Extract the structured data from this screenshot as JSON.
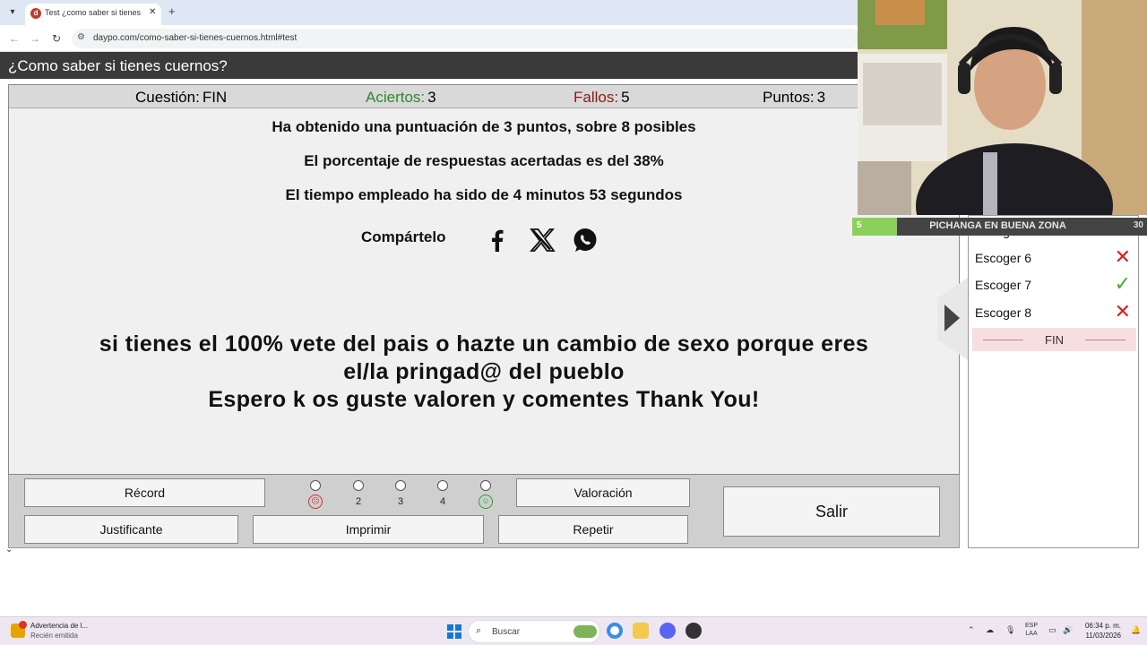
{
  "browser": {
    "tab_title": "Test ¿como saber si tienes cuernos?",
    "favicon_letter": "d",
    "url": "daypo.com/como-saber-si-tienes-cuernos.html#test"
  },
  "page": {
    "title": "¿Como saber si tienes cuernos?"
  },
  "stats": {
    "question_label": "Cuestión:",
    "question_value": "FIN",
    "correct_label": "Aciertos:",
    "correct_value": "3",
    "wrong_label": "Fallos:",
    "wrong_value": "5",
    "points_label": "Puntos:",
    "points_value": "3"
  },
  "results": {
    "line1": "Ha obtenido una puntuación de 3 puntos, sobre 8 posibles",
    "line2": "El porcentaje de respuestas acertadas es del 38%",
    "line3": "El tiempo empleado ha sido de 4 minutos 53 segundos",
    "share_label": "Compártelo",
    "share_icons": [
      "facebook-icon",
      "x-icon",
      "whatsapp-icon"
    ]
  },
  "message": {
    "line1": "si tienes el 100% vete del pais o hazte un cambio de sexo porque eres",
    "line2": "el/la pringad@ del pueblo",
    "line3": "Espero k os guste valoren y comentes Thank You!"
  },
  "bottom": {
    "record": "Récord",
    "valoracion": "Valoración",
    "justificante": "Justificante",
    "imprimir": "Imprimir",
    "repetir": "Repetir",
    "salir": "Salir",
    "rating_labels": [
      "2",
      "3",
      "4"
    ]
  },
  "side": {
    "items": [
      {
        "label": "Escoger 5",
        "result": "correct"
      },
      {
        "label": "Escoger 6",
        "result": "wrong"
      },
      {
        "label": "Escoger 7",
        "result": "correct"
      },
      {
        "label": "Escoger 8",
        "result": "wrong"
      }
    ],
    "fin_label": "FIN"
  },
  "stream": {
    "level_left": "5",
    "name": "PICHANGA EN BUENA ZONA",
    "level_right": "30"
  },
  "taskbar": {
    "notif_title": "Advertencia de l...",
    "notif_sub": "Recién emitida",
    "search_placeholder": "Buscar",
    "lang1": "ESP",
    "lang2": "LAA",
    "time": "06:34 p. m.",
    "date": "11/03/2026"
  },
  "colors": {
    "correct": "#2c8a2c",
    "wrong": "#8b1a1a",
    "check": "#3cb01e",
    "cross": "#d62020"
  }
}
